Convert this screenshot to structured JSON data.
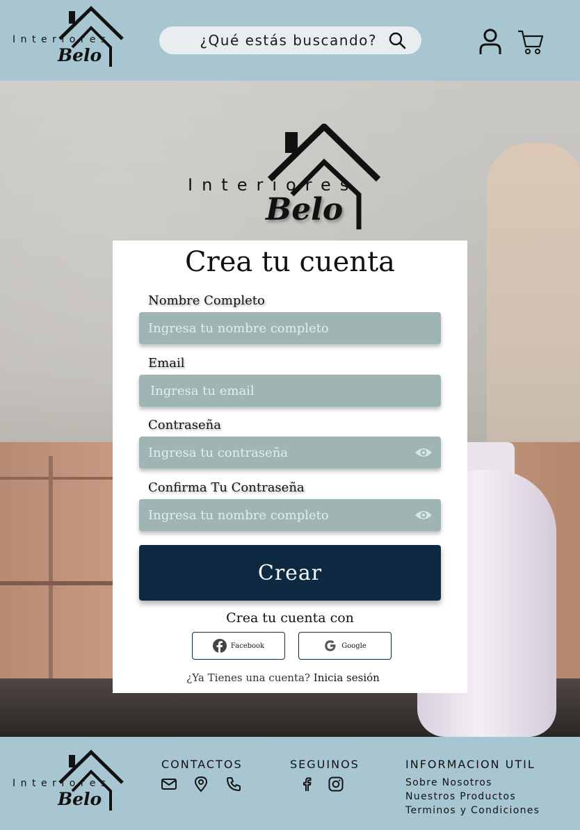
{
  "brand": {
    "line1": "Interiores",
    "line2": "Belo"
  },
  "header": {
    "search_placeholder": "¿Qué estás buscando?",
    "icons": [
      "search-icon",
      "user-icon",
      "cart-icon"
    ]
  },
  "form": {
    "title": "Crea tu cuenta",
    "fields": [
      {
        "label": "Nombre Completo",
        "placeholder": "Ingresa tu nombre completo",
        "has_eye": false
      },
      {
        "label": "Email",
        "placeholder": "Ingresa tu email",
        "has_eye": false
      },
      {
        "label": "Contraseña",
        "placeholder": "Ingresa tu contraseña",
        "has_eye": true
      },
      {
        "label": "Confirma Tu Contraseña",
        "placeholder": "Ingresa tu nombre completo",
        "has_eye": true
      }
    ],
    "submit_label": "Crear",
    "social_title": "Crea tu cuenta con",
    "social": [
      {
        "label": "Facebook",
        "icon": "facebook-icon"
      },
      {
        "label": "Google",
        "icon": "google-icon"
      }
    ],
    "login_prompt": "¿Ya Tienes una cuenta?",
    "login_link": "Inicia sesión"
  },
  "footer": {
    "contactos_title": "CONTACTOS",
    "contact_icons": [
      "mail-icon",
      "location-icon",
      "phone-icon"
    ],
    "seguinos_title": "SEGUINOS",
    "social_icons": [
      "facebook-icon",
      "instagram-icon"
    ],
    "info_title": "INFORMACION UTIL",
    "info_links": [
      "Sobre Nosotros",
      "Nuestros Productos",
      "Terminos y Condiciones"
    ]
  },
  "colors": {
    "header_bg": "#a7c6d1",
    "field_bg": "#9fb5b3",
    "button_bg": "#0e2a42",
    "card_bg": "#ffffff"
  }
}
